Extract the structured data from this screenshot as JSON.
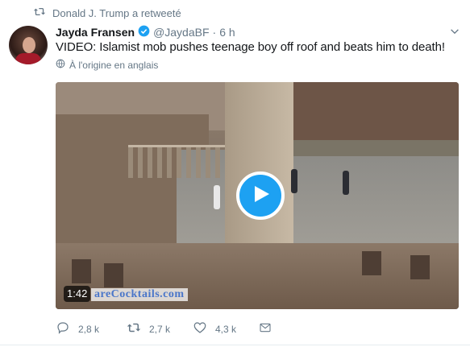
{
  "retweet_context": {
    "label": "Donald J. Trump a retweeté"
  },
  "tweet": {
    "author_name": "Jayda Fransen",
    "author_handle": "@JaydaBF",
    "separator": "·",
    "timestamp": "6 h",
    "text": "VIDEO: Islamist mob pushes teenage boy off roof and beats him to death!",
    "translation_label": "À l'origine en anglais",
    "media": {
      "duration": "1:42",
      "watermark": "areCocktails.com"
    }
  },
  "actions": {
    "replies": "2,8 k",
    "retweets": "2,7 k",
    "likes": "4,3 k"
  },
  "icons": {
    "retweet": "retweet-icon",
    "verified": "verified-badge-icon",
    "caret": "chevron-down-icon",
    "globe": "globe-icon",
    "play": "play-icon",
    "reply": "reply-icon",
    "like": "heart-icon",
    "dm": "envelope-icon"
  },
  "colors": {
    "accent": "#1da1f2",
    "muted": "#657786",
    "text": "#14171a"
  }
}
